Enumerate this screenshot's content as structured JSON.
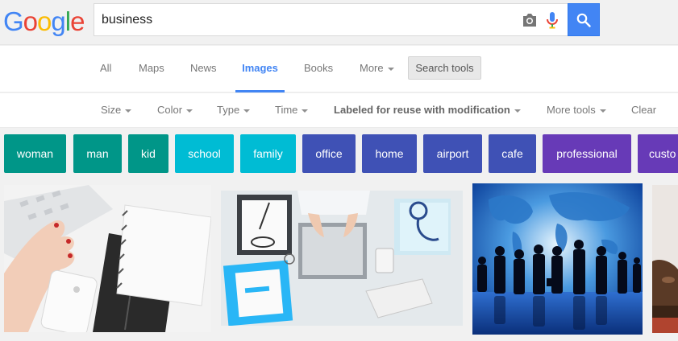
{
  "logo": {
    "letters": [
      {
        "ch": "G",
        "color": "#4285f4"
      },
      {
        "ch": "o",
        "color": "#ea4335"
      },
      {
        "ch": "o",
        "color": "#fbbc05"
      },
      {
        "ch": "g",
        "color": "#4285f4"
      },
      {
        "ch": "l",
        "color": "#34a853"
      },
      {
        "ch": "e",
        "color": "#ea4335"
      }
    ]
  },
  "search": {
    "query": "business",
    "button_icon": "search-icon"
  },
  "nav": {
    "tabs": [
      {
        "label": "All"
      },
      {
        "label": "Maps"
      },
      {
        "label": "News"
      },
      {
        "label": "Images",
        "active": true
      },
      {
        "label": "Books"
      },
      {
        "label": "More"
      }
    ],
    "tools_label": "Search tools"
  },
  "filters": [
    {
      "label": "Size"
    },
    {
      "label": "Color"
    },
    {
      "label": "Type"
    },
    {
      "label": "Time"
    },
    {
      "label": "Labeled for reuse with modification"
    },
    {
      "label": "More tools"
    },
    {
      "label": "Clear"
    }
  ],
  "chips": [
    {
      "label": "woman",
      "color": "#009688"
    },
    {
      "label": "man",
      "color": "#009688"
    },
    {
      "label": "kid",
      "color": "#009688"
    },
    {
      "label": "school",
      "color": "#00bcd4"
    },
    {
      "label": "family",
      "color": "#00bcd4"
    },
    {
      "label": "office",
      "color": "#3f51b5"
    },
    {
      "label": "home",
      "color": "#3f51b5"
    },
    {
      "label": "airport",
      "color": "#3f51b5"
    },
    {
      "label": "cafe",
      "color": "#3f51b5"
    },
    {
      "label": "professional",
      "color": "#673ab7"
    },
    {
      "label": "custo",
      "color": "#673ab7"
    }
  ],
  "colors": {
    "accent": "#4285f4",
    "background": "#f1f1f1"
  }
}
